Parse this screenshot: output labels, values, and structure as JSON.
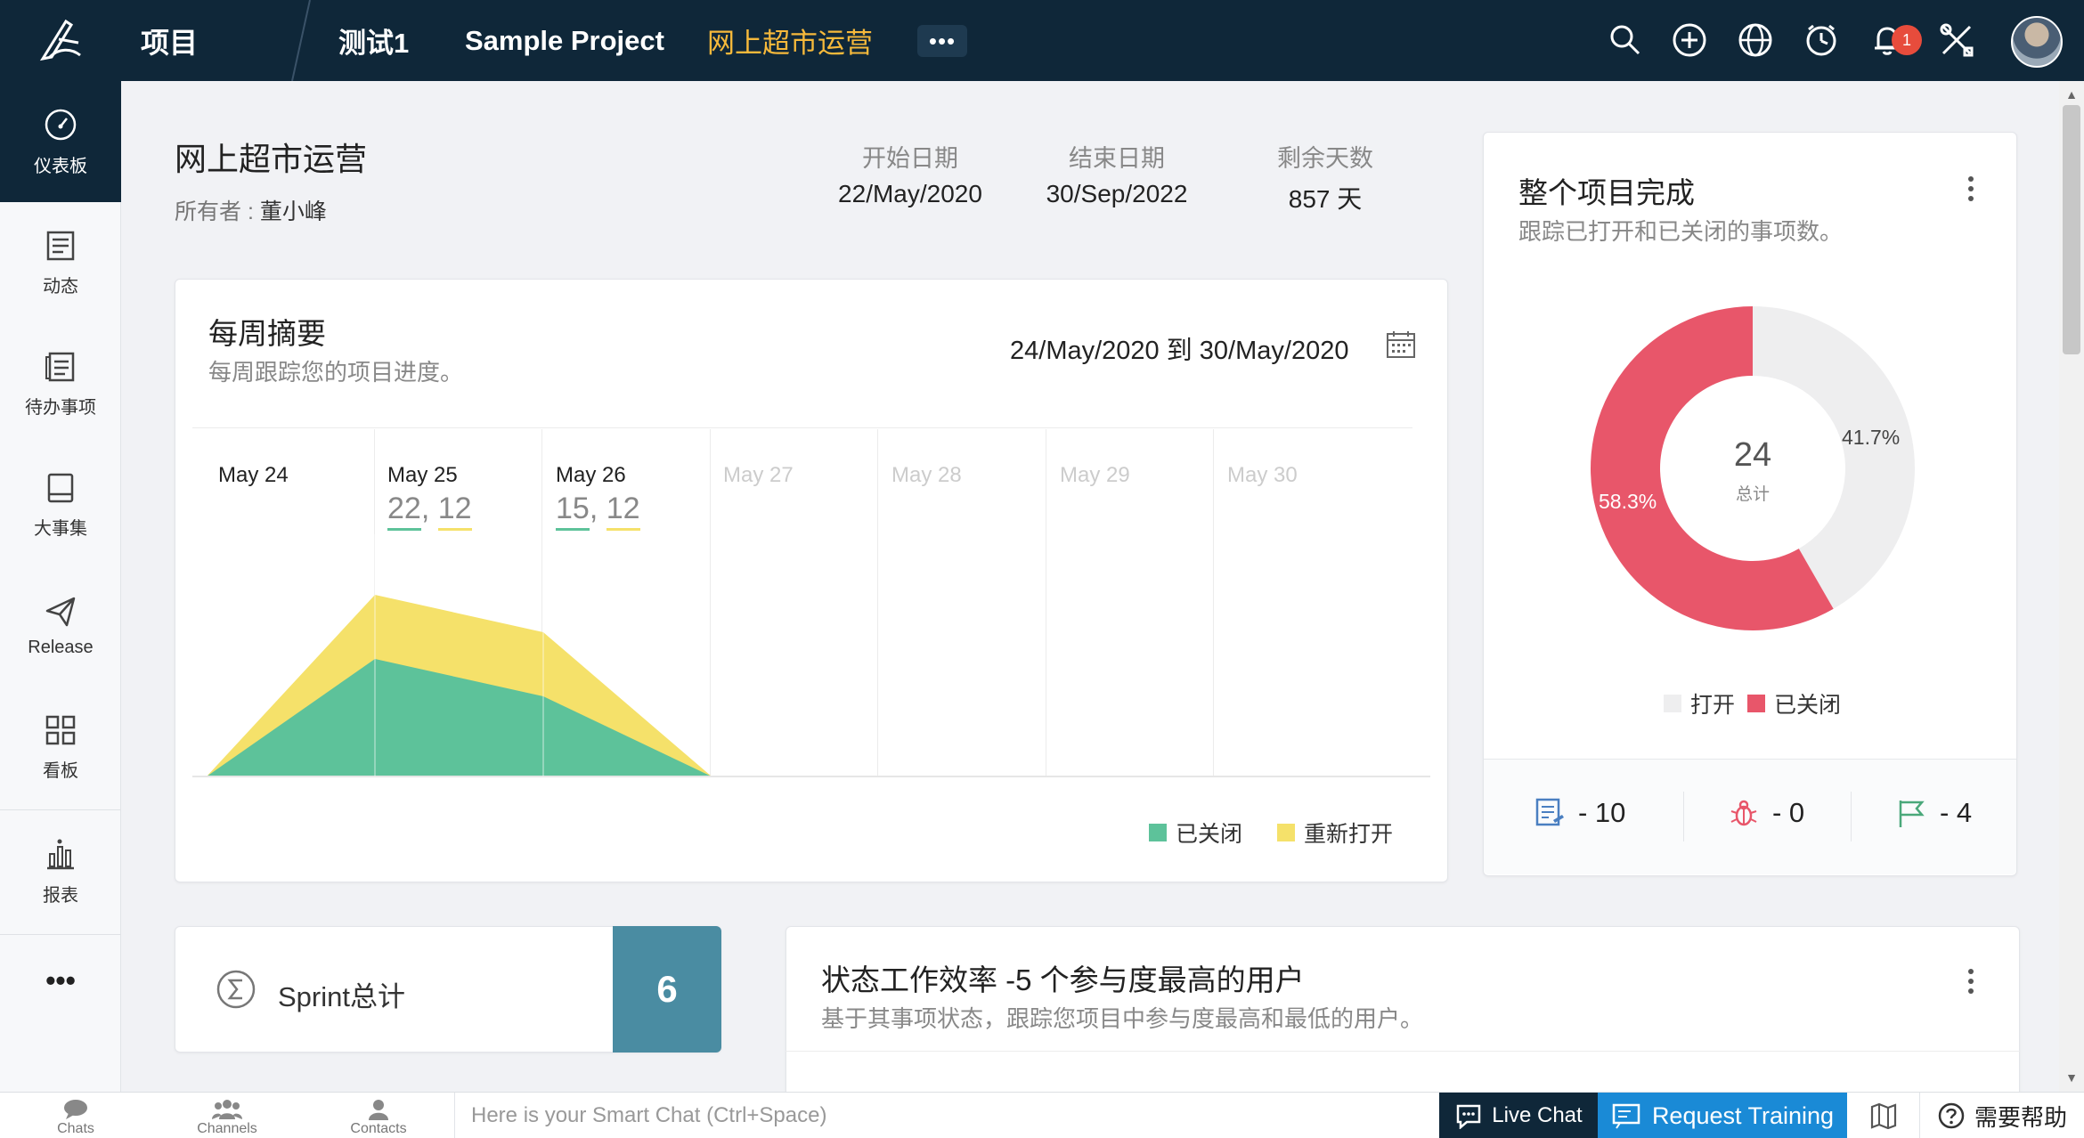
{
  "topbar": {
    "projects_label": "项目",
    "crumbs": [
      "测试1",
      "Sample Project",
      "网上超市运营"
    ],
    "more_label": "•••",
    "notif_count": "1"
  },
  "sidebar": {
    "items": [
      {
        "label": "仪表板",
        "icon": "dashboard-icon"
      },
      {
        "label": "动态",
        "icon": "feed-icon"
      },
      {
        "label": "待办事项",
        "icon": "backlog-icon"
      },
      {
        "label": "大事集",
        "icon": "epic-icon"
      },
      {
        "label": "Release",
        "icon": "release-icon"
      },
      {
        "label": "看板",
        "icon": "board-icon"
      },
      {
        "label": "报表",
        "icon": "report-icon"
      }
    ],
    "more_label": "•••"
  },
  "project": {
    "title": "网上超市运营",
    "owner_label": "所有者 : ",
    "owner": "董小峰",
    "start_label": "开始日期",
    "start": "22/May/2020",
    "end_label": "结束日期",
    "end": "30/Sep/2022",
    "remain_label": "剩余天数",
    "remain": "857 天"
  },
  "weekly": {
    "title": "每周摘要",
    "subtitle": "每周跟踪您的项目进度。",
    "date_range": "24/May/2020  到  30/May/2020",
    "days": [
      {
        "label": "May 24",
        "a": "",
        "b": ""
      },
      {
        "label": "May 25",
        "a": "22",
        "b": "12"
      },
      {
        "label": "May 26",
        "a": "15",
        "b": "12"
      },
      {
        "label": "May 27"
      },
      {
        "label": "May 28"
      },
      {
        "label": "May 29"
      },
      {
        "label": "May 30"
      }
    ],
    "legend_closed": "已关闭",
    "legend_reopen": "重新打开",
    "colors": {
      "closed": "#5dc29a",
      "reopen": "#f5e16a"
    }
  },
  "chart_data": {
    "type": "area",
    "categories": [
      "May 24",
      "May 25",
      "May 26",
      "May 27"
    ],
    "series": [
      {
        "name": "已关闭",
        "values": [
          0,
          22,
          15,
          0
        ]
      },
      {
        "name": "重新打开",
        "values": [
          0,
          12,
          12,
          0
        ]
      }
    ],
    "title": "每周摘要",
    "grid": true,
    "legend": "bottom-right"
  },
  "completion": {
    "title": "整个项目完成",
    "subtitle": "跟踪已打开和已关闭的事项数。",
    "total": "24",
    "total_label": "总计",
    "open_pct": "41.7%",
    "closed_pct": "58.3%",
    "open_value": 41.7,
    "closed_value": 58.3,
    "legend_open": "打开",
    "legend_closed": "已关闭",
    "colors": {
      "open": "#eeeeef",
      "closed": "#e8566a"
    },
    "footer": {
      "items_label": "- 10",
      "bugs_label": "- 0",
      "milestones_label": "- 4"
    }
  },
  "sprint": {
    "label": "Sprint总计",
    "count": "6"
  },
  "efficiency": {
    "title": "状态工作效率 -5 个参与度最高的用户",
    "subtitle": "基于其事项状态，跟踪您项目中参与度最高和最低的用户。"
  },
  "bottombar": {
    "chats": "Chats",
    "channels": "Channels",
    "contacts": "Contacts",
    "chat_placeholder": "Here is your Smart Chat (Ctrl+Space)",
    "live_chat": "Live Chat",
    "request_training": "Request Training",
    "help": "需要帮助"
  }
}
